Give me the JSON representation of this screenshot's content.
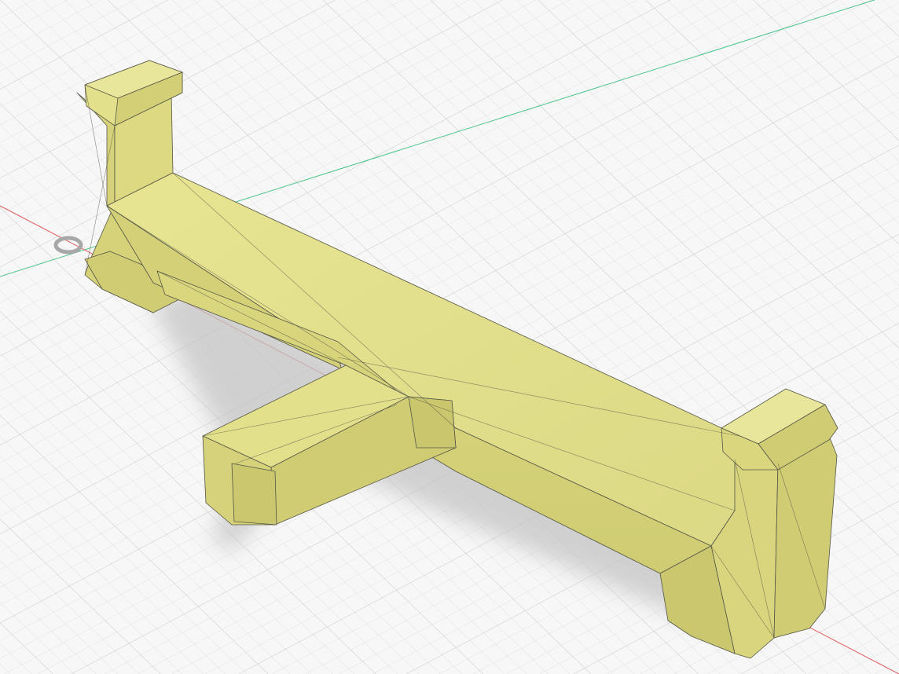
{
  "viewport": {
    "background": "#f7f7f7",
    "grid_minor_color": "#e1e1e1",
    "grid_major_color": "#cdcdcd",
    "x_axis_color": "#e06060",
    "y_axis_color": "#4cc48a"
  },
  "model": {
    "body_color": "#e3e08c",
    "top_face_color": "#e6e48f",
    "front_face_color": "#d9d67e",
    "side_face_color": "#cfcc74",
    "edge_color": "#555546",
    "shadow_color": "#c4c4c4"
  },
  "origin_marker": {
    "icon": "origin-ring-icon"
  }
}
